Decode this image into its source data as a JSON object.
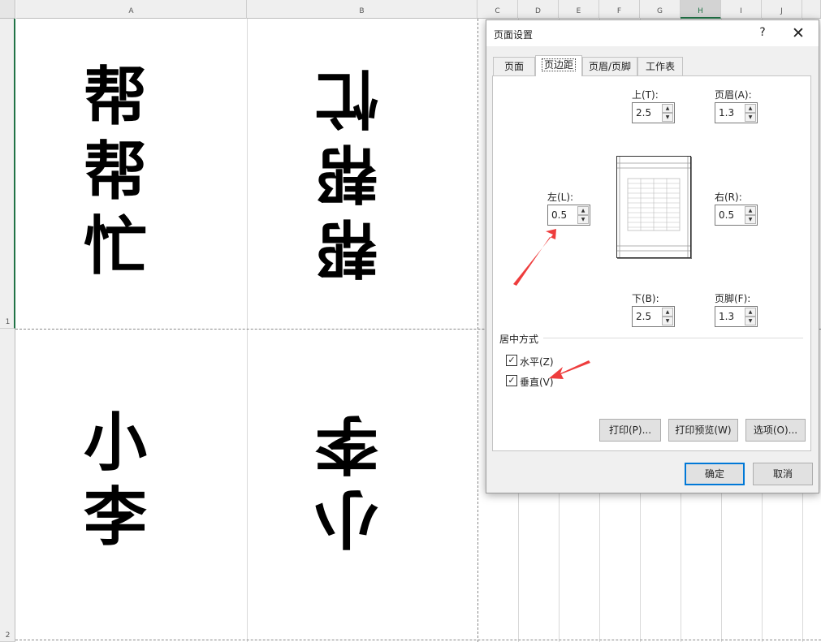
{
  "sheet": {
    "columns": [
      "A",
      "B",
      "C",
      "D",
      "E",
      "F",
      "G",
      "H",
      "I",
      "J"
    ],
    "selected_column": "H",
    "rows": [
      "1",
      "2"
    ],
    "cell_a1": [
      "帮",
      "帮",
      "忙"
    ],
    "cell_b1": [
      "帮",
      "帮",
      "忙"
    ],
    "cell_a2": [
      "小",
      "李"
    ],
    "cell_b2": [
      "小",
      "李"
    ]
  },
  "dialog": {
    "title": "页面设置",
    "help_label": "?",
    "close_label": "✕",
    "tabs": [
      {
        "label": "页面"
      },
      {
        "label": "页边距"
      },
      {
        "label": "页眉/页脚"
      },
      {
        "label": "工作表"
      }
    ],
    "active_tab": "页边距",
    "margins": {
      "top": {
        "label": "上(T):",
        "value": "2.5"
      },
      "header": {
        "label": "页眉(A):",
        "value": "1.3"
      },
      "left": {
        "label": "左(L):",
        "value": "0.5"
      },
      "right": {
        "label": "右(R):",
        "value": "0.5"
      },
      "bottom": {
        "label": "下(B):",
        "value": "2.5"
      },
      "footer": {
        "label": "页脚(F):",
        "value": "1.3"
      }
    },
    "centering": {
      "group_label": "居中方式",
      "horizontal": {
        "label": "水平(Z)",
        "checked": true
      },
      "vertical": {
        "label": "垂直(V)",
        "checked": true
      }
    },
    "buttons": {
      "print": "打印(P)...",
      "print_preview": "打印预览(W)",
      "options": "选项(O)...",
      "ok": "确定",
      "cancel": "取消"
    },
    "check_mark": "✓",
    "spin_up": "▲",
    "spin_down": "▼"
  },
  "colors": {
    "annotation_arrow": "#ee3d3d",
    "excel_green": "#217346",
    "focus_blue": "#0078d7"
  }
}
